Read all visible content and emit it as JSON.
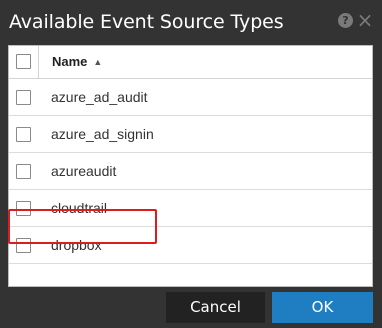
{
  "dialog": {
    "title": "Available Event Source Types",
    "help_icon": "question-circle-icon",
    "help_glyph": "?",
    "close_icon": "close-icon",
    "close_glyph": "×"
  },
  "table": {
    "header": {
      "name": "Name",
      "sort_icon": "sort-ascending-icon",
      "sort_glyph": "▲"
    },
    "rows": [
      {
        "label": "azure_ad_audit",
        "checked": false
      },
      {
        "label": "azure_ad_signin",
        "checked": false
      },
      {
        "label": "azureaudit",
        "checked": false
      },
      {
        "label": "cloudtrail",
        "checked": false
      },
      {
        "label": "dropbox",
        "checked": false
      }
    ]
  },
  "footer": {
    "cancel_label": "Cancel",
    "ok_label": "OK"
  },
  "colors": {
    "dialog_bg": "#333333",
    "ok_button": "#1f7ec1",
    "highlight": "#e01b1b"
  }
}
